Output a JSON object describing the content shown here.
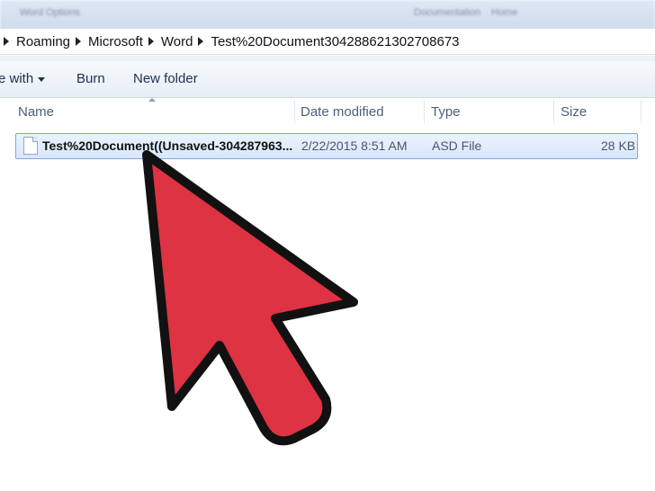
{
  "background_window": {
    "title": "Word Options",
    "item_1": "Documentation",
    "item_2": "Home"
  },
  "breadcrumb": [
    "Roaming",
    "Microsoft",
    "Word",
    "Test%20Document304288621302708673"
  ],
  "toolbar": {
    "share_with_label": "e with",
    "burn_label": "Burn",
    "new_folder_label": "New folder"
  },
  "columns": {
    "name": "Name",
    "date_modified": "Date modified",
    "type": "Type",
    "size": "Size"
  },
  "files": [
    {
      "name": "Test%20Document((Unsaved-304287963...",
      "date_modified": "2/22/2015 8:51 AM",
      "type": "ASD File",
      "size": "28 KB",
      "selected": true
    }
  ],
  "pointer_arrow": {
    "icon": "cursor-arrow-icon",
    "fill": "#dd3343",
    "stroke": "#111111"
  }
}
